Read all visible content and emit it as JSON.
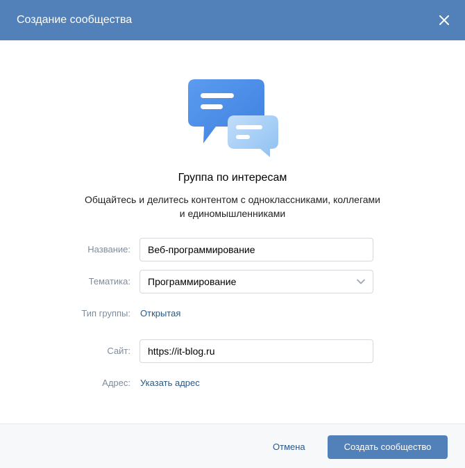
{
  "header": {
    "title": "Создание сообщества",
    "close_icon": "close-icon"
  },
  "hero": {
    "icon": "chat-bubbles-icon",
    "colors": {
      "back_bubble": "#4a8fe8",
      "front_bubble": "#a8cff7"
    }
  },
  "group": {
    "title": "Группа по интересам",
    "description": "Общайтесь и делитесь контентом с одноклассниками, коллегами и единомышленниками"
  },
  "form": {
    "name": {
      "label": "Название:",
      "value": "Веб-программирование"
    },
    "topic": {
      "label": "Тематика:",
      "value": "Программирование",
      "icon": "chevron-down-icon"
    },
    "type": {
      "label": "Тип группы:",
      "value": "Открытая"
    },
    "site": {
      "label": "Сайт:",
      "value": "https://it-blog.ru"
    },
    "address": {
      "label": "Адрес:",
      "link": "Указать адрес"
    }
  },
  "footer": {
    "cancel_label": "Отмена",
    "create_label": "Создать сообщество"
  },
  "colors": {
    "accent": "#5181b8",
    "link": "#2a5885",
    "label": "#818c99",
    "border": "#d3d9de"
  }
}
